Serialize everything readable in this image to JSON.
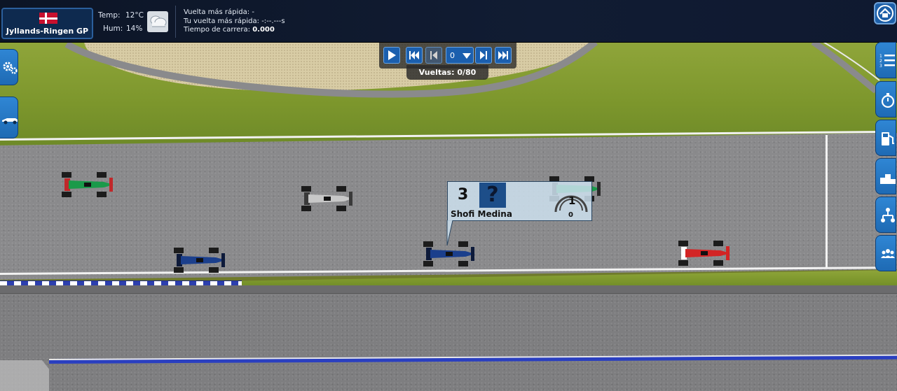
{
  "race": {
    "gp_name": "Jyllands-Ringen GP",
    "flag": "denmark-flag",
    "temp_label": "Temp:",
    "temp_value": "12°C",
    "hum_label": "Hum:",
    "hum_value": "14%",
    "weather_icon": "cloudy-icon"
  },
  "info": {
    "fastest_lap_label": "Vuelta más rápida:",
    "fastest_lap_value": "-",
    "your_fastest_lap_label": "Tu vuelta más rápida:",
    "your_fastest_lap_value": "-:--.---s",
    "race_time_label": "Tiempo de carrera:",
    "race_time_value": "0.000"
  },
  "controls": {
    "lap_selected": "0",
    "laps_label": "Vueltas:",
    "laps_value": "0/80",
    "buttons": [
      "play-icon",
      "skip-to-start-icon",
      "step-back-icon",
      "step-forward-icon",
      "skip-to-end-icon"
    ]
  },
  "sidebar_left": [
    "settings-gears-icon",
    "car-setup-icon"
  ],
  "sidebar_right": [
    "standings-list-icon",
    "stopwatch-icon",
    "fuel-pump-icon",
    "podium-icon",
    "strategy-tree-icon",
    "drivers-group-icon"
  ],
  "driver_tooltip": {
    "position": "3",
    "portrait": "?",
    "name": "Shofi Medina",
    "gear": "1",
    "speed": "0"
  },
  "cars": [
    {
      "team_color": "#1a9a4a",
      "accent": "#c0282a"
    },
    {
      "team_color": "#c8c8c8",
      "accent": "#3a3a3a"
    },
    {
      "team_color": "#1a9a4a",
      "accent": "#2a2a2a"
    },
    {
      "team_color": "#1b3f8c",
      "accent": "#0d1a3a"
    },
    {
      "team_color": "#1b3f8c",
      "accent": "#0d1a3a"
    },
    {
      "team_color": "#d32424",
      "accent": "#ffffff"
    }
  ],
  "colors": {
    "accent_blue": "#1e6ab4",
    "topbar": "#0c1526",
    "asphalt": "#8a8a8c",
    "grass": "#7c962c"
  }
}
